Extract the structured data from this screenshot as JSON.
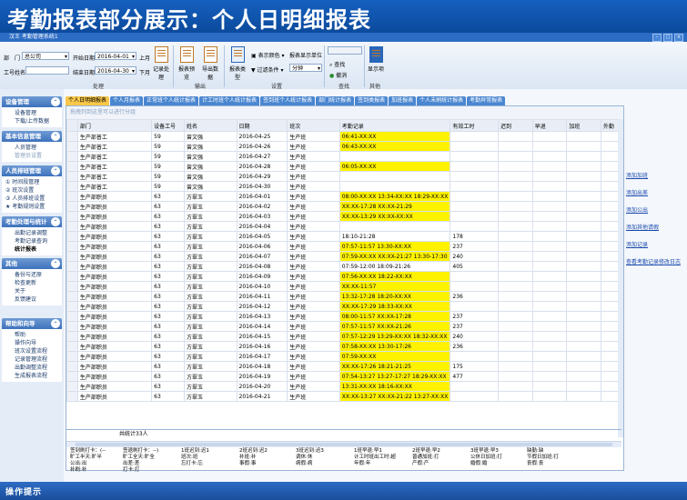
{
  "banner": {
    "title": "考勤报表部分展示：个人日明细报表"
  },
  "window": {
    "title": "汉王 考勤管理系统1"
  },
  "toolbar": {
    "dept_label": "部　门",
    "dept_value": "总公司",
    "emp_label": "工号姓名",
    "emp_value": "",
    "start_label": "开始日期",
    "start_value": "2016-04-01",
    "end_label": "结束日期",
    "end_value": "2016-04-30",
    "prev_month": "上月",
    "next_month": "下月",
    "record_process": "记录处理",
    "report_preview": "报表预览",
    "export_data": "导出数据",
    "report_type": "报表类型",
    "show_color": "表示颜色",
    "filter_cond": "过滤条件",
    "unit_label": "报表显示单位",
    "unit_value": "分钟",
    "search": "查找",
    "undo": "撤消",
    "display": "显示项",
    "group_process": "处理",
    "group_output": "输出",
    "group_settings": "设置",
    "group_search": "查找",
    "group_other": "其他"
  },
  "sidebar": {
    "groups": [
      {
        "title": "设备管理",
        "items": [
          "设备管理",
          "下载/上传数据"
        ]
      },
      {
        "title": "基本信息管理",
        "items": [
          "人员管理",
          "管理员设置"
        ]
      },
      {
        "title": "人员排班管理",
        "items": [
          "① 时间段管理",
          "② 班次设置",
          "③ 人员排班设置",
          "★ 考勤规则设置"
        ]
      },
      {
        "title": "考勤处理与统计",
        "items": [
          "出勤记录调整",
          "考勤记录查询",
          "统计报表"
        ]
      },
      {
        "title": "其他",
        "items": [
          "备份与还原",
          "检查更新",
          "关于",
          "反馈建议"
        ]
      },
      {
        "title": "帮助和向导",
        "items": [
          "帮助",
          "操作向导",
          "班次设置流程",
          "记录管理流程",
          "出勤调整流程",
          "生成报表流程"
        ]
      }
    ]
  },
  "tabs": [
    "个人日明细报表",
    "个人月报表",
    "正常班个人统计报表",
    "计工时班个人统计报表",
    "签到班个人统计报表",
    "部门统计报表",
    "签到类报表",
    "加班报表",
    "个人未刷统计报表",
    "考勤异常报表"
  ],
  "grid": {
    "group_hint": "拖拽列到这里可以进行分组",
    "columns": [
      "部门",
      "设备工号",
      "姓名",
      "日期",
      "班次",
      "考勤记录",
      "有效工时",
      "迟到",
      "早退",
      "加班",
      "外勤"
    ],
    "rows": [
      {
        "dept": "生产部普工",
        "id": "59",
        "name": "曾文强",
        "date": "2016-04-25",
        "shift": "生产班",
        "rec": "06:41-XX:XX",
        "hrs": "",
        "y": true
      },
      {
        "dept": "生产部普工",
        "id": "59",
        "name": "曾文强",
        "date": "2016-04-26",
        "shift": "生产班",
        "rec": "06:43-XX:XX",
        "hrs": "",
        "y": true
      },
      {
        "dept": "生产部普工",
        "id": "59",
        "name": "曾文强",
        "date": "2016-04-27",
        "shift": "生产班",
        "rec": "",
        "hrs": "",
        "y": false
      },
      {
        "dept": "生产部普工",
        "id": "59",
        "name": "曾文强",
        "date": "2016-04-28",
        "shift": "生产班",
        "rec": "06:05-XX:XX",
        "hrs": "",
        "y": true
      },
      {
        "dept": "生产部普工",
        "id": "59",
        "name": "曾文强",
        "date": "2016-04-29",
        "shift": "生产班",
        "rec": "",
        "hrs": "",
        "y": false
      },
      {
        "dept": "生产部普工",
        "id": "59",
        "name": "曾文强",
        "date": "2016-04-30",
        "shift": "生产班",
        "rec": "",
        "hrs": "",
        "y": false
      },
      {
        "dept": "生产部职员",
        "id": "63",
        "name": "方翠玉",
        "date": "2016-04-01",
        "shift": "生产班",
        "rec": "08:00-XX:XX 13:34-XX:XX 18:29-XX:XX",
        "hrs": "",
        "y": true
      },
      {
        "dept": "生产部职员",
        "id": "63",
        "name": "方翠玉",
        "date": "2016-04-02",
        "shift": "生产班",
        "rec": "XX:XX-17:28 XX:XX-21:29",
        "hrs": "",
        "y": true
      },
      {
        "dept": "生产部职员",
        "id": "63",
        "name": "方翠玉",
        "date": "2016-04-03",
        "shift": "生产班",
        "rec": "XX:XX-13:29 XX:XX-XX:XX",
        "hrs": "",
        "y": true
      },
      {
        "dept": "生产部职员",
        "id": "63",
        "name": "方翠玉",
        "date": "2016-04-04",
        "shift": "生产班",
        "rec": "",
        "hrs": "",
        "y": false
      },
      {
        "dept": "生产部职员",
        "id": "63",
        "name": "方翠玉",
        "date": "2016-04-05",
        "shift": "生产班",
        "rec": "18:10-21:28",
        "hrs": "178",
        "y": false
      },
      {
        "dept": "生产部职员",
        "id": "63",
        "name": "方翠玉",
        "date": "2016-04-06",
        "shift": "生产班",
        "rec": "07:57-11:57 13:30-XX:XX",
        "hrs": "237",
        "y": true
      },
      {
        "dept": "生产部职员",
        "id": "63",
        "name": "方翠玉",
        "date": "2016-04-07",
        "shift": "生产班",
        "rec": "07:59-XX:XX XX:XX-21:27 13:30-17:30",
        "hrs": "240",
        "y": true
      },
      {
        "dept": "生产部职员",
        "id": "63",
        "name": "方翠玉",
        "date": "2016-04-08",
        "shift": "生产班",
        "rec": "07:59-12:00 18:09-21:26",
        "hrs": "405",
        "y": false
      },
      {
        "dept": "生产部职员",
        "id": "63",
        "name": "方翠玉",
        "date": "2016-04-09",
        "shift": "生产班",
        "rec": "07:56-XX:XX 18:22-XX:XX",
        "hrs": "",
        "y": true
      },
      {
        "dept": "生产部职员",
        "id": "63",
        "name": "方翠玉",
        "date": "2016-04-10",
        "shift": "生产班",
        "rec": "XX:XX-11:57",
        "hrs": "",
        "y": true
      },
      {
        "dept": "生产部职员",
        "id": "63",
        "name": "方翠玉",
        "date": "2016-04-11",
        "shift": "生产班",
        "rec": "13:32-17:28 18:20-XX:XX",
        "hrs": "236",
        "y": true
      },
      {
        "dept": "生产部职员",
        "id": "63",
        "name": "方翠玉",
        "date": "2016-04-12",
        "shift": "生产班",
        "rec": "XX:XX-17:29 18:33-XX:XX",
        "hrs": "",
        "y": true
      },
      {
        "dept": "生产部职员",
        "id": "63",
        "name": "方翠玉",
        "date": "2016-04-13",
        "shift": "生产班",
        "rec": "08:00-11:57 XX:XX-17:28",
        "hrs": "237",
        "y": true
      },
      {
        "dept": "生产部职员",
        "id": "63",
        "name": "方翠玉",
        "date": "2016-04-14",
        "shift": "生产班",
        "rec": "07:57-11:57 XX:XX-21:26",
        "hrs": "237",
        "y": true
      },
      {
        "dept": "生产部职员",
        "id": "63",
        "name": "方翠玉",
        "date": "2016-04-15",
        "shift": "生产班",
        "rec": "07:57-12:29 13:29-XX:XX 18:32-XX:XX",
        "hrs": "240",
        "y": true
      },
      {
        "dept": "生产部职员",
        "id": "63",
        "name": "方翠玉",
        "date": "2016-04-16",
        "shift": "生产班",
        "rec": "07:58-XX:XX 13:30-17:26",
        "hrs": "236",
        "y": true
      },
      {
        "dept": "生产部职员",
        "id": "63",
        "name": "方翠玉",
        "date": "2016-04-17",
        "shift": "生产班",
        "rec": "07:59-XX:XX",
        "hrs": "",
        "y": true
      },
      {
        "dept": "生产部职员",
        "id": "63",
        "name": "方翠玉",
        "date": "2016-04-18",
        "shift": "生产班",
        "rec": "XX:XX-17:26 18:21-21:25",
        "hrs": "175",
        "y": true
      },
      {
        "dept": "生产部职员",
        "id": "63",
        "name": "方翠玉",
        "date": "2016-04-19",
        "shift": "生产班",
        "rec": "07:54-13:27 13:27-17:27 18:29-XX:XX",
        "hrs": "477",
        "y": true
      },
      {
        "dept": "生产部职员",
        "id": "63",
        "name": "方翠玉",
        "date": "2016-04-20",
        "shift": "生产班",
        "rec": "13:31-XX:XX 18:16-XX:XX",
        "hrs": "",
        "y": true
      },
      {
        "dept": "生产部职员",
        "id": "63",
        "name": "方翠玉",
        "date": "2016-04-21",
        "shift": "生产班",
        "rec": "XX:XX-13:27 XX:XX-21:22 13:27-XX:XX",
        "hrs": "",
        "y": true
      }
    ],
    "total": "共统计33人"
  },
  "legend": [
    [
      "签到刷打卡：(--",
      "旷工半天:旷半",
      "公出:出",
      "补刷:补"
    ],
    [
      "签退刷打卡：--)",
      "旷工全天:旷全",
      "出差:差",
      "打卡:打"
    ],
    [
      "1班迟到:迟1",
      "班次:班",
      "忘打卡:忘"
    ],
    [
      "2班迟到:迟2",
      "补班:补",
      "事假:事"
    ],
    [
      "3班迟到:迟3",
      "调休:休",
      "病假:病"
    ],
    [
      "1班早退:早1",
      "计工时班出工时:超",
      "年假:年"
    ],
    [
      "2班早退:早2",
      "普通加班:打",
      "产假:产"
    ],
    [
      "3班早退:早3",
      "公休日加班:打",
      "婚假:婚"
    ],
    [
      "缺勤:缺",
      "节假日加班:打",
      "丧假:丧"
    ]
  ],
  "links": [
    "添加加班",
    "添加出差",
    "添加公出",
    "添加其他请假",
    "添加记录",
    "查看考勤记录修改日志"
  ],
  "status": {
    "title": "操作提示"
  }
}
